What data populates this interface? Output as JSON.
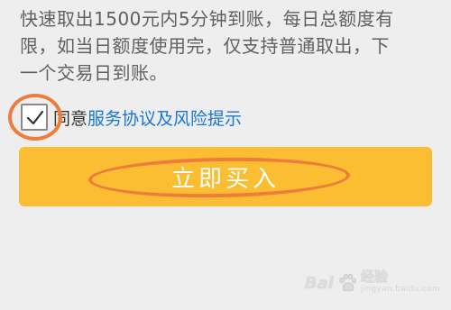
{
  "notice": {
    "lines": [
      "快速取出1500元内5分钟到账，每日总额度有",
      "限，如当日额度使用完，仅支持普通取出，下",
      "一个交易日到账。"
    ]
  },
  "agreement": {
    "checked": true,
    "prefix": "同意",
    "link_text": "服务协议及风险提示"
  },
  "buy_button": {
    "label": "立即买入"
  },
  "colors": {
    "button_bg": "#fbbe33",
    "link": "#1976d2",
    "annotation": "#ee7d3b",
    "page_bg": "#eeeeee"
  },
  "watermark": {
    "logo_text": "Bai",
    "logo_suffix": "经验",
    "url": "jingyan.baidu.com"
  }
}
